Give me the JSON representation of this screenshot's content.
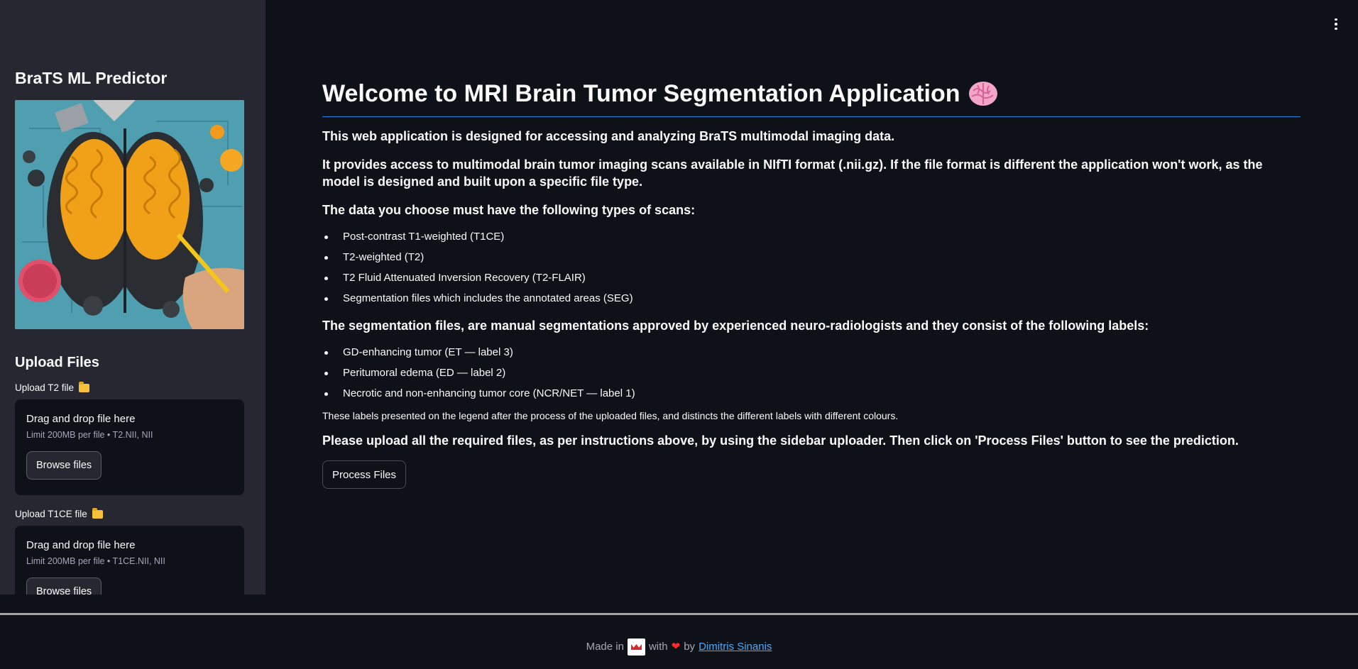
{
  "sidebar": {
    "title": "BraTS ML Predictor",
    "upload_heading": "Upload Files",
    "uploaders": [
      {
        "label": "Upload T2 file",
        "drop_text": "Drag and drop file here",
        "limit_text": "Limit 200MB per file • T2.NII, NII",
        "button": "Browse files"
      },
      {
        "label": "Upload T1CE file",
        "drop_text": "Drag and drop file here",
        "limit_text": "Limit 200MB per file • T1CE.NII, NII",
        "button": "Browse files"
      }
    ]
  },
  "main": {
    "title": "Welcome to MRI Brain Tumor Segmentation Application",
    "intro": "This web application is designed for accessing and analyzing BraTS multimodal imaging data.",
    "format_note": "It provides access to multimodal brain tumor imaging scans available in NIfTI format (.nii.gz). If the file format is different the application won't work, as the model is designed and built upon a specific file type.",
    "scan_types_heading": "The data you choose must have the following types of scans:",
    "scan_types": [
      "Post-contrast T1-weighted (T1CE)",
      "T2-weighted (T2)",
      "T2 Fluid Attenuated Inversion Recovery (T2-FLAIR)",
      "Segmentation files which includes the annotated areas (SEG)"
    ],
    "labels_heading": "The segmentation files, are manual segmentations approved by experienced neuro-radiologists and they consist of the following labels:",
    "labels": [
      "GD-enhancing tumor (ET — label 3)",
      "Peritumoral edema (ED — label 2)",
      "Necrotic and non-enhancing tumor core (NCR/NET — label 1)"
    ],
    "legend_note": "These labels presented on the legend after the process of the uploaded files, and distincts the different labels with different colours.",
    "instruction": "Please upload all the required files, as per instructions above, by using the sidebar uploader. Then click on 'Process Files' button to see the prediction.",
    "process_button": "Process Files"
  },
  "footer": {
    "made_in": "Made in",
    "with": "with",
    "by": "by",
    "author": "Dimitris Sinanis"
  },
  "icons": {
    "menu": "kebab-menu-icon",
    "brain": "brain-icon",
    "folder": "folder-icon",
    "flag": "flag-icon",
    "heart": "heart-icon"
  },
  "colors": {
    "background": "#0e1117",
    "sidebar": "#262730",
    "accent_underline": "#1c83e1",
    "link": "#4ea8f4"
  }
}
